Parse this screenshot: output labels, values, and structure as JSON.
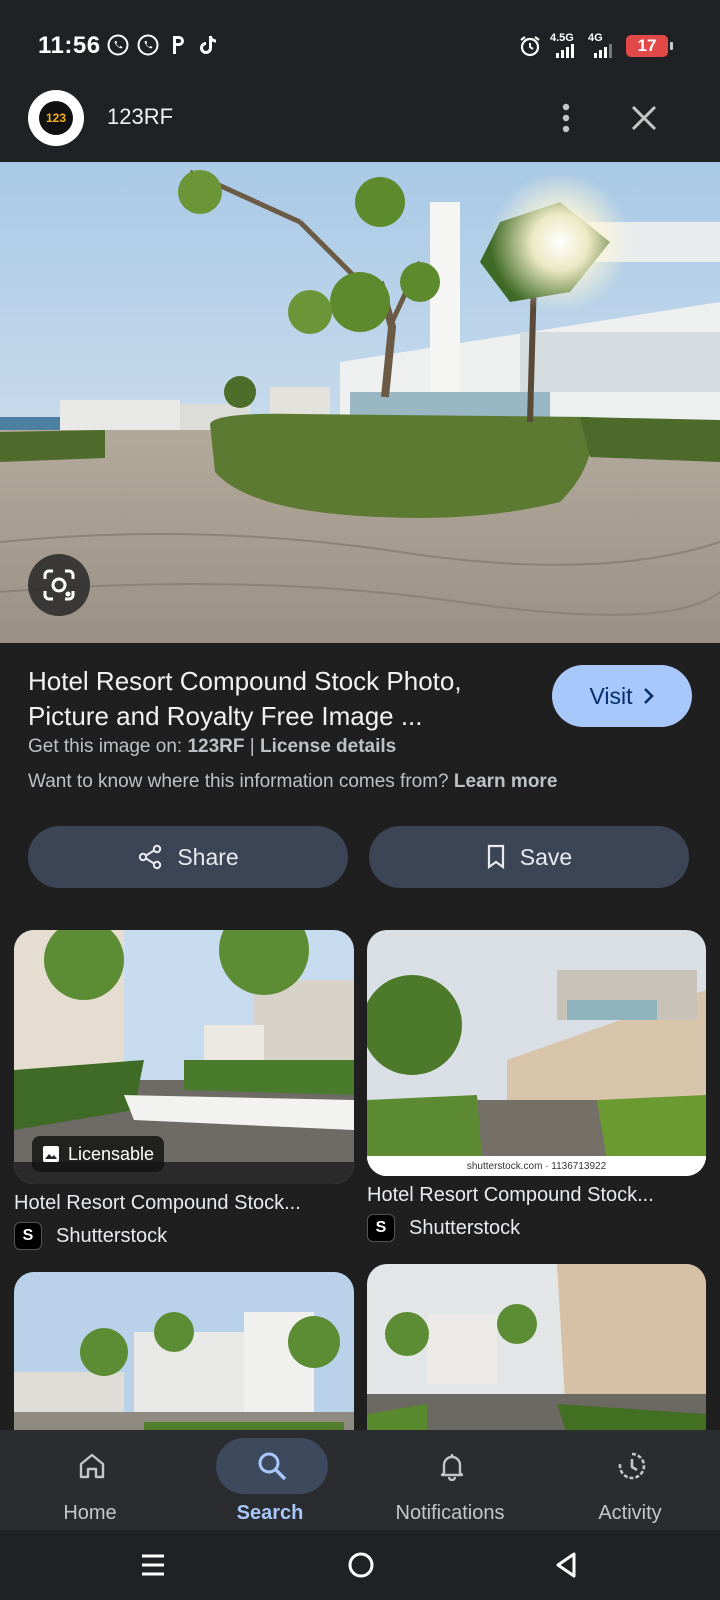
{
  "status_bar": {
    "time": "11:56",
    "net1": "4.5G",
    "net2": "4G",
    "battery": "17"
  },
  "header": {
    "logo_text": "123",
    "site_name": "123RF"
  },
  "result": {
    "title": "Hotel Resort Compound Stock Photo, Picture and Royalty Free Image ...",
    "visit_label": "Visit",
    "source_prefix": "Get this image on: ",
    "source_name": "123RF",
    "source_sep": " | ",
    "license_link": "License details",
    "info_prefix": "Want to know where this information comes from? ",
    "learn_more": "Learn more",
    "share_label": "Share",
    "save_label": "Save"
  },
  "related": [
    {
      "title": "Hotel Resort Compound Stock...",
      "source": "Shutterstock",
      "badge": "Licensable"
    },
    {
      "title": "Hotel Resort Compound Stock...",
      "source": "Shutterstock",
      "caption": "shutterstock.com · 1136713922"
    }
  ],
  "bottom_nav": {
    "home": "Home",
    "search": "Search",
    "notifications": "Notifications",
    "activity": "Activity"
  },
  "colors": {
    "accent": "#a8c7fa",
    "background": "#1f1f1f",
    "button_bg": "#3b4556"
  }
}
